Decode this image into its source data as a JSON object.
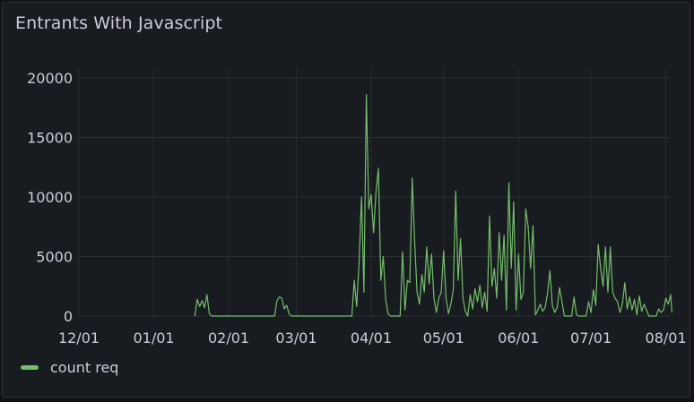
{
  "panel": {
    "title": "Entrants With Javascript"
  },
  "chart_data": {
    "type": "line",
    "title": "Entrants With Javascript",
    "xlabel": "",
    "ylabel": "",
    "x_range": [
      "2021-12-01",
      "2022-08-03"
    ],
    "ylim": [
      0,
      20000
    ],
    "y_ticks": [
      0,
      5000,
      10000,
      15000,
      20000
    ],
    "x_ticks": [
      "12/01",
      "01/01",
      "02/01",
      "03/01",
      "04/01",
      "05/01",
      "06/01",
      "07/01",
      "08/01"
    ],
    "x_tick_dates": [
      "2021-12-01",
      "2022-01-01",
      "2022-02-01",
      "2022-03-01",
      "2022-04-01",
      "2022-05-01",
      "2022-06-01",
      "2022-07-01",
      "2022-08-01"
    ],
    "grid": true,
    "legend_placement": "bottom-left",
    "series": [
      {
        "name": "count req",
        "color": "#73bf69",
        "points": [
          [
            "2022-01-18",
            0
          ],
          [
            "2022-01-19",
            1400
          ],
          [
            "2022-01-20",
            800
          ],
          [
            "2022-01-21",
            1300
          ],
          [
            "2022-01-22",
            700
          ],
          [
            "2022-01-23",
            1800
          ],
          [
            "2022-01-24",
            200
          ],
          [
            "2022-01-25",
            0
          ],
          [
            "2022-02-15",
            0
          ],
          [
            "2022-02-20",
            0
          ],
          [
            "2022-02-21",
            1300
          ],
          [
            "2022-02-22",
            1600
          ],
          [
            "2022-02-23",
            1500
          ],
          [
            "2022-02-24",
            600
          ],
          [
            "2022-02-25",
            900
          ],
          [
            "2022-02-26",
            200
          ],
          [
            "2022-02-27",
            0
          ],
          [
            "2022-03-24",
            0
          ],
          [
            "2022-03-25",
            3000
          ],
          [
            "2022-03-26",
            800
          ],
          [
            "2022-03-27",
            4500
          ],
          [
            "2022-03-28",
            10000
          ],
          [
            "2022-03-29",
            2000
          ],
          [
            "2022-03-30",
            18600
          ],
          [
            "2022-03-31",
            9000
          ],
          [
            "2022-04-01",
            10200
          ],
          [
            "2022-04-02",
            7000
          ],
          [
            "2022-04-03",
            10400
          ],
          [
            "2022-04-04",
            12400
          ],
          [
            "2022-04-05",
            3000
          ],
          [
            "2022-04-06",
            5000
          ],
          [
            "2022-04-07",
            1400
          ],
          [
            "2022-04-08",
            200
          ],
          [
            "2022-04-09",
            0
          ],
          [
            "2022-04-13",
            0
          ],
          [
            "2022-04-14",
            5400
          ],
          [
            "2022-04-15",
            500
          ],
          [
            "2022-04-16",
            3000
          ],
          [
            "2022-04-17",
            2800
          ],
          [
            "2022-04-18",
            11600
          ],
          [
            "2022-04-19",
            6200
          ],
          [
            "2022-04-20",
            2000
          ],
          [
            "2022-04-21",
            1000
          ],
          [
            "2022-04-22",
            3500
          ],
          [
            "2022-04-23",
            2000
          ],
          [
            "2022-04-24",
            5800
          ],
          [
            "2022-04-25",
            2700
          ],
          [
            "2022-04-26",
            5200
          ],
          [
            "2022-04-27",
            1500
          ],
          [
            "2022-04-28",
            300
          ],
          [
            "2022-04-29",
            1500
          ],
          [
            "2022-04-30",
            2000
          ],
          [
            "2022-05-01",
            5500
          ],
          [
            "2022-05-02",
            1500
          ],
          [
            "2022-05-03",
            200
          ],
          [
            "2022-05-04",
            1000
          ],
          [
            "2022-05-05",
            2200
          ],
          [
            "2022-05-06",
            10500
          ],
          [
            "2022-05-07",
            3000
          ],
          [
            "2022-05-08",
            6500
          ],
          [
            "2022-05-09",
            1500
          ],
          [
            "2022-05-10",
            400
          ],
          [
            "2022-05-11",
            0
          ],
          [
            "2022-05-12",
            1800
          ],
          [
            "2022-05-13",
            600
          ],
          [
            "2022-05-14",
            2300
          ],
          [
            "2022-05-15",
            1200
          ],
          [
            "2022-05-16",
            2600
          ],
          [
            "2022-05-17",
            700
          ],
          [
            "2022-05-18",
            2000
          ],
          [
            "2022-05-19",
            400
          ],
          [
            "2022-05-20",
            8400
          ],
          [
            "2022-05-21",
            2500
          ],
          [
            "2022-05-22",
            4000
          ],
          [
            "2022-05-23",
            1500
          ],
          [
            "2022-05-24",
            7000
          ],
          [
            "2022-05-25",
            3000
          ],
          [
            "2022-05-26",
            6800
          ],
          [
            "2022-05-27",
            500
          ],
          [
            "2022-05-28",
            11200
          ],
          [
            "2022-05-29",
            4000
          ],
          [
            "2022-05-30",
            9600
          ],
          [
            "2022-05-31",
            500
          ],
          [
            "2022-06-01",
            5200
          ],
          [
            "2022-06-02",
            1400
          ],
          [
            "2022-06-03",
            2000
          ],
          [
            "2022-06-04",
            9000
          ],
          [
            "2022-06-05",
            7500
          ],
          [
            "2022-06-06",
            4000
          ],
          [
            "2022-06-07",
            7600
          ],
          [
            "2022-06-08",
            100
          ],
          [
            "2022-06-09",
            500
          ],
          [
            "2022-06-10",
            1000
          ],
          [
            "2022-06-11",
            400
          ],
          [
            "2022-06-12",
            700
          ],
          [
            "2022-06-13",
            1900
          ],
          [
            "2022-06-14",
            3800
          ],
          [
            "2022-06-15",
            900
          ],
          [
            "2022-06-16",
            300
          ],
          [
            "2022-06-17",
            700
          ],
          [
            "2022-06-18",
            2400
          ],
          [
            "2022-06-19",
            1200
          ],
          [
            "2022-06-20",
            0
          ],
          [
            "2022-06-23",
            0
          ],
          [
            "2022-06-24",
            1600
          ],
          [
            "2022-06-25",
            100
          ],
          [
            "2022-06-26",
            0
          ],
          [
            "2022-06-29",
            0
          ],
          [
            "2022-06-30",
            1200
          ],
          [
            "2022-07-01",
            300
          ],
          [
            "2022-07-02",
            2200
          ],
          [
            "2022-07-03",
            900
          ],
          [
            "2022-07-04",
            6000
          ],
          [
            "2022-07-05",
            4000
          ],
          [
            "2022-07-06",
            2500
          ],
          [
            "2022-07-07",
            5800
          ],
          [
            "2022-07-08",
            2000
          ],
          [
            "2022-07-09",
            5800
          ],
          [
            "2022-07-10",
            2000
          ],
          [
            "2022-07-11",
            1500
          ],
          [
            "2022-07-12",
            1200
          ],
          [
            "2022-07-13",
            300
          ],
          [
            "2022-07-14",
            1000
          ],
          [
            "2022-07-15",
            2800
          ],
          [
            "2022-07-16",
            600
          ],
          [
            "2022-07-17",
            1600
          ],
          [
            "2022-07-18",
            500
          ],
          [
            "2022-07-19",
            1400
          ],
          [
            "2022-07-20",
            100
          ],
          [
            "2022-07-21",
            1700
          ],
          [
            "2022-07-22",
            400
          ],
          [
            "2022-07-23",
            1000
          ],
          [
            "2022-07-24",
            500
          ],
          [
            "2022-07-25",
            0
          ],
          [
            "2022-07-28",
            0
          ],
          [
            "2022-07-29",
            600
          ],
          [
            "2022-07-30",
            300
          ],
          [
            "2022-07-31",
            500
          ],
          [
            "2022-08-01",
            1500
          ],
          [
            "2022-08-02",
            1000
          ],
          [
            "2022-08-03",
            1800
          ],
          [
            "2022-08-03T12:00",
            300
          ]
        ]
      }
    ]
  },
  "legend": {
    "items": [
      {
        "label": "count req",
        "color": "#73bf69"
      }
    ]
  }
}
